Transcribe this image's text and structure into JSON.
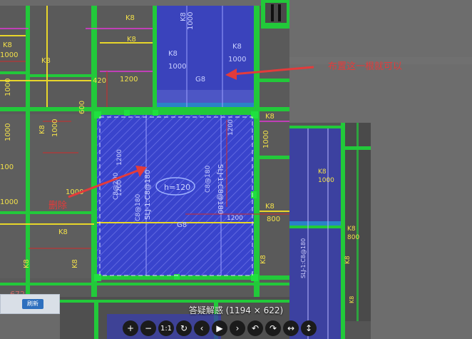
{
  "viewer": {
    "caption": "答疑解惑 (1194 × 622)",
    "toolbar": [
      {
        "id": "zoom-in",
        "glyph": "+"
      },
      {
        "id": "zoom-out",
        "glyph": "−"
      },
      {
        "id": "actual-size",
        "glyph": "1:1"
      },
      {
        "id": "rotate",
        "glyph": "↻"
      },
      {
        "id": "prev",
        "glyph": "‹"
      },
      {
        "id": "play",
        "glyph": "▶"
      },
      {
        "id": "next",
        "glyph": "›"
      },
      {
        "id": "undo",
        "glyph": "↶"
      },
      {
        "id": "redo",
        "glyph": "↷"
      },
      {
        "id": "fit-width",
        "glyph": "↔"
      },
      {
        "id": "fit-height",
        "glyph": "↕"
      }
    ]
  },
  "annotations": {
    "top_note": "布置这一根就可以",
    "left_note": "删除"
  },
  "drawing": {
    "labels_k8": "K8",
    "label_1000": "1000",
    "label_1200": "1200",
    "label_800": "800",
    "label_600": "600",
    "label_100": "100",
    "label_420": "420",
    "label_672": "672",
    "label_g8": "G8",
    "label_c8200": "C8@200",
    "label_c8180": "C8@180",
    "slab_h": "h=120",
    "slab_mark_1": "SLJ-1:C8@180",
    "slab_mark_2": "SLJ-1:C8@180",
    "slab_mark_3": "SLJ-1:C8@180"
  },
  "mini_panel": {
    "button": "刷新"
  },
  "colors": {
    "wall": "#22c93a",
    "slab": "#3540c9",
    "background": "#5c5c5c",
    "accent": "#e33b3b"
  }
}
